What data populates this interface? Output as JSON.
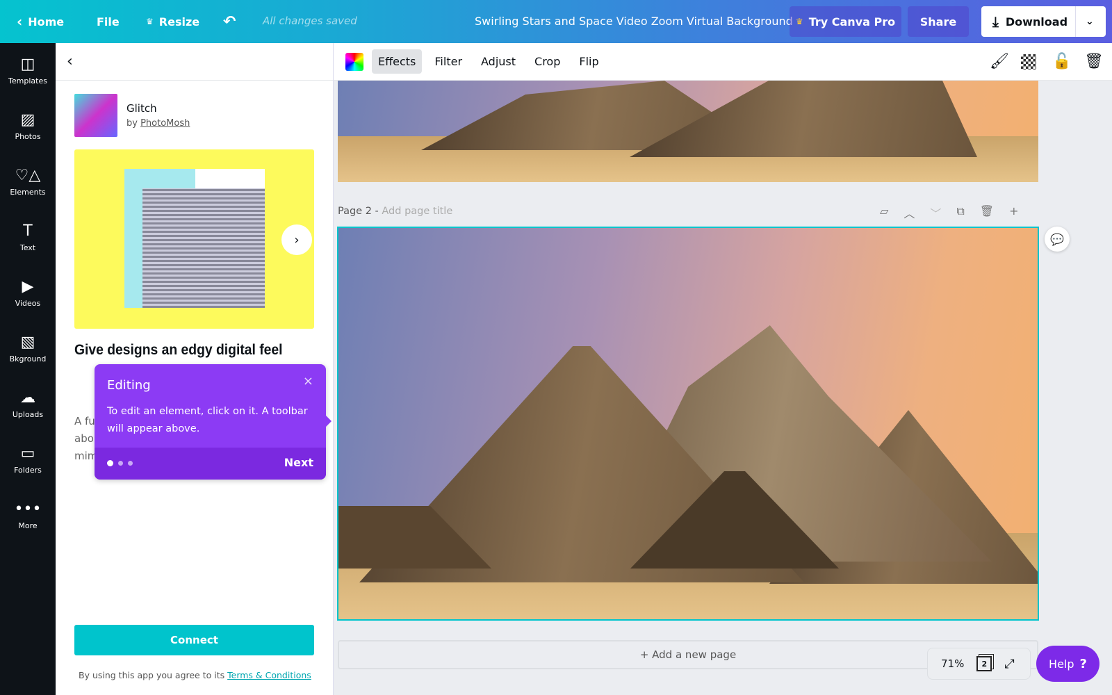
{
  "topbar": {
    "home": "Home",
    "file": "File",
    "resize": "Resize",
    "saved": "All changes saved",
    "title": "Swirling Stars and Space Video Zoom Virtual Background",
    "try_pro": "Try Canva Pro",
    "share": "Share",
    "download": "Download"
  },
  "rail": [
    {
      "label": "Templates",
      "icon": "templates-icon"
    },
    {
      "label": "Photos",
      "icon": "photos-icon"
    },
    {
      "label": "Elements",
      "icon": "elements-icon"
    },
    {
      "label": "Text",
      "icon": "text-icon"
    },
    {
      "label": "Videos",
      "icon": "videos-icon"
    },
    {
      "label": "Bkground",
      "icon": "background-icon"
    },
    {
      "label": "Uploads",
      "icon": "uploads-icon"
    },
    {
      "label": "Folders",
      "icon": "folders-icon"
    },
    {
      "label": "More",
      "icon": "more-icon"
    }
  ],
  "panel": {
    "app_name": "Glitch",
    "by": "by",
    "author": "PhotoMosh",
    "heading": "Give designs an edgy digital feel",
    "desc_fragments": [
      "A fu",
      "abo",
      "mim"
    ],
    "connect": "Connect",
    "terms_prefix": "By using this app you agree to its",
    "terms_link": "Terms & Conditions"
  },
  "toolbar": {
    "effects": "Effects",
    "filter": "Filter",
    "adjust": "Adjust",
    "crop": "Crop",
    "flip": "Flip"
  },
  "page2": {
    "label": "Page 2 -",
    "title_placeholder": "Add page title"
  },
  "add_page": "+ Add a new page",
  "zoom": "71%",
  "page_count": "2",
  "help": "Help",
  "tooltip": {
    "title": "Editing",
    "body": "To edit an element, click on it. A toolbar will appear above.",
    "next": "Next",
    "step": 1,
    "steps": 3
  },
  "colors": {
    "accent": "#00c4cc",
    "tooltip": "#8c3bf4",
    "help": "#7d2ae8"
  }
}
